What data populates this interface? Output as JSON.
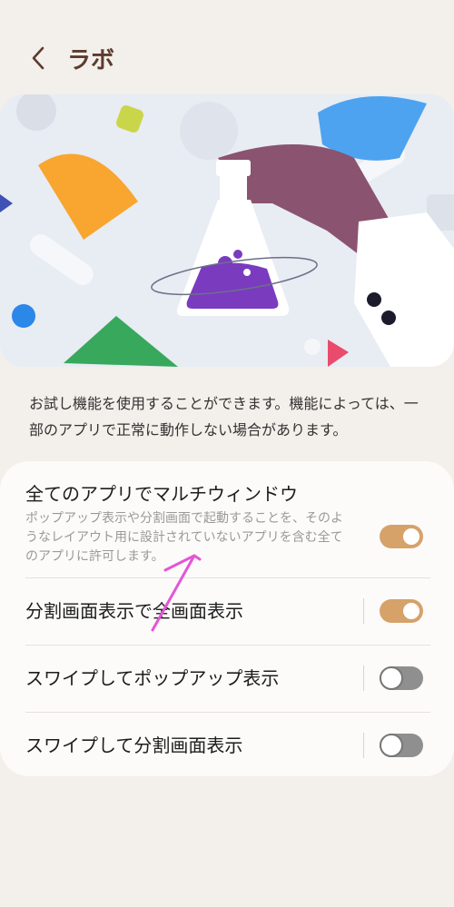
{
  "header": {
    "title": "ラボ",
    "back_icon": "chevron-left-icon"
  },
  "description": "お試し機能を使用することができます。機能によっては、一部のアプリで正常に動作しない場合があります。",
  "settings": [
    {
      "title": "全てのアプリでマルチウィンドウ",
      "subtitle": "ポップアップ表示や分割画面で起動することを、そのようなレイアウト用に設計されていないアプリを含む全てのアプリに許可します。",
      "enabled": true
    },
    {
      "title": "分割画面表示で全画面表示",
      "enabled": true
    },
    {
      "title": "スワイプしてポップアップ表示",
      "enabled": false
    },
    {
      "title": "スワイプして分割画面表示",
      "enabled": false
    }
  ],
  "colors": {
    "accent": "#d6a26a",
    "title": "#5c3b2e",
    "background": "#f3efea"
  }
}
